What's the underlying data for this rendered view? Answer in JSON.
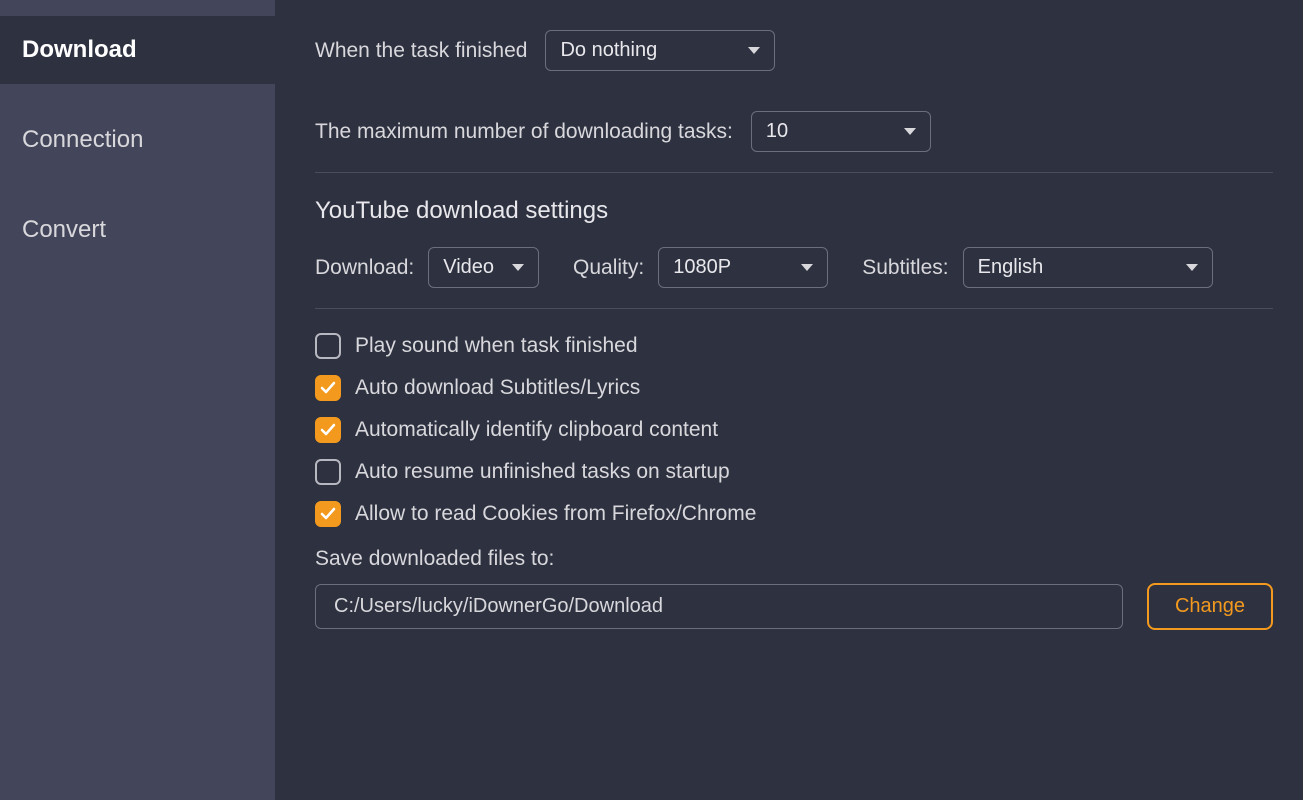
{
  "sidebar": {
    "items": [
      {
        "label": "Download",
        "active": true
      },
      {
        "label": "Connection",
        "active": false
      },
      {
        "label": "Convert",
        "active": false
      }
    ]
  },
  "settings": {
    "task_finished_label": "When the task finished",
    "task_finished_value": "Do nothing",
    "max_tasks_label": "The maximum number of downloading tasks:",
    "max_tasks_value": "10",
    "youtube_section_title": "YouTube download settings",
    "download_label": "Download:",
    "download_value": "Video",
    "quality_label": "Quality:",
    "quality_value": "1080P",
    "subtitles_label": "Subtitles:",
    "subtitles_value": "English",
    "checkboxes": [
      {
        "label": "Play sound when task finished",
        "checked": false
      },
      {
        "label": "Auto download Subtitles/Lyrics",
        "checked": true
      },
      {
        "label": "Automatically identify clipboard content",
        "checked": true
      },
      {
        "label": "Auto resume unfinished tasks on startup",
        "checked": false
      },
      {
        "label": "Allow to read Cookies from Firefox/Chrome",
        "checked": true
      }
    ],
    "save_path_label": "Save downloaded files to:",
    "save_path_value": "C:/Users/lucky/iDownerGo/Download",
    "change_button": "Change"
  }
}
